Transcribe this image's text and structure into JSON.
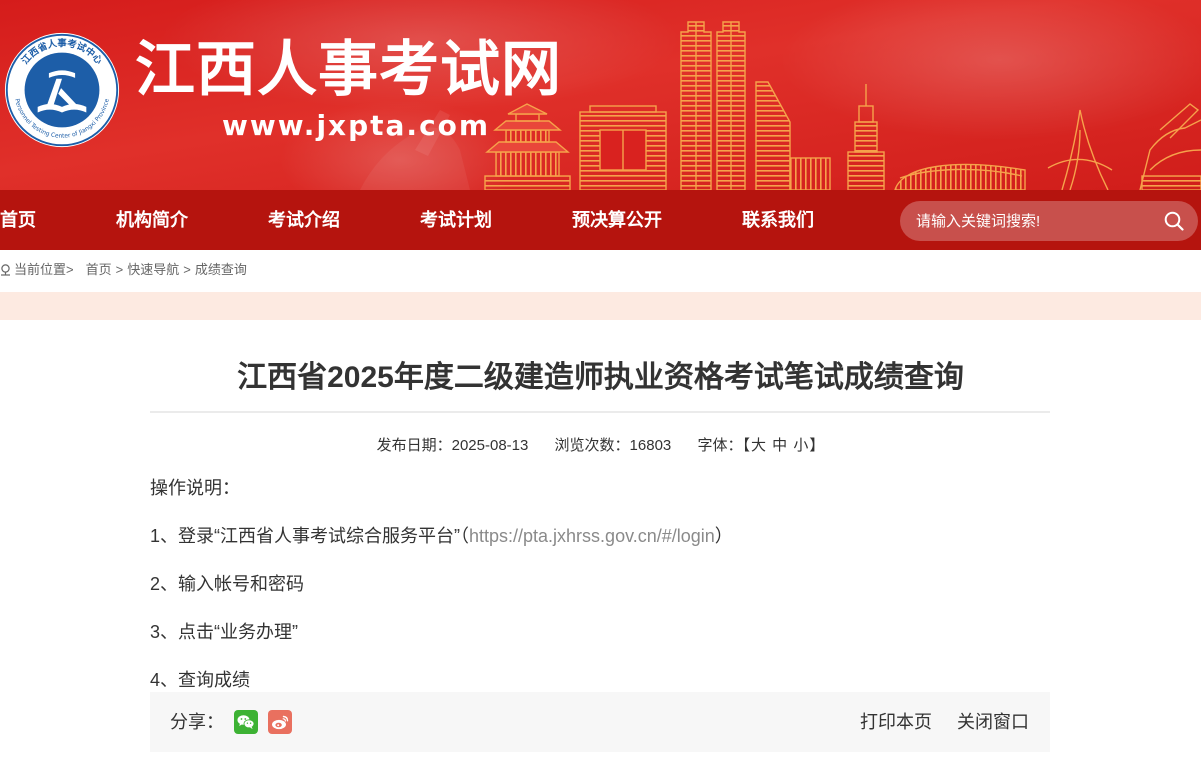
{
  "logo": {
    "cn_name": "江西省人事考试中心",
    "en_name": "Personnel Testing Center of Jiangxi Province"
  },
  "site": {
    "title": "江西人事考试网",
    "url": "www.jxpta.com"
  },
  "nav": {
    "items": [
      "首页",
      "机构简介",
      "考试介绍",
      "考试计划",
      "预决算公开",
      "联系我们"
    ]
  },
  "search": {
    "placeholder": "请输入关键词搜索!",
    "icon": "search-icon"
  },
  "breadcrumb": {
    "label": "当前位置>",
    "separator": ">",
    "items": [
      "首页",
      "快速导航",
      "成绩查询"
    ]
  },
  "article": {
    "title": "江西省2025年度二级建造师执业资格考试笔试成绩查询",
    "meta": {
      "date_label": "发布日期：",
      "date": "2025-08-13",
      "views_label": "浏览次数：",
      "views": "16803",
      "font_label": "字体：",
      "font_open": "【",
      "font_sizes": [
        "大",
        "中",
        "小"
      ],
      "font_close": "】"
    },
    "body": {
      "intro": "操作说明：",
      "step1_prefix": "1、登录“江西省人事考试综合服务平台”",
      "step1_paren_open": "（",
      "step1_link": "https://pta.jxhrss.gov.cn/#/login",
      "step1_paren_close": "）",
      "step2": "2、输入帐号和密码",
      "step3": "3、点击“业务办理”",
      "step4": "4、查询成绩"
    }
  },
  "share": {
    "label": "分享：",
    "icons": [
      "wechat-icon",
      "weibo-icon"
    ],
    "print": "打印本页",
    "close": "关闭窗口"
  },
  "colors": {
    "banner_red": "#d9221f",
    "nav_red": "#b5140e",
    "band_peach": "#fdeae1",
    "building_orange": "#f6a24b",
    "logo_blue": "#1d5ea8",
    "link_gray": "#8a8a8a",
    "wechat_green": "#3db234",
    "weibo_red": "#e9705f"
  }
}
